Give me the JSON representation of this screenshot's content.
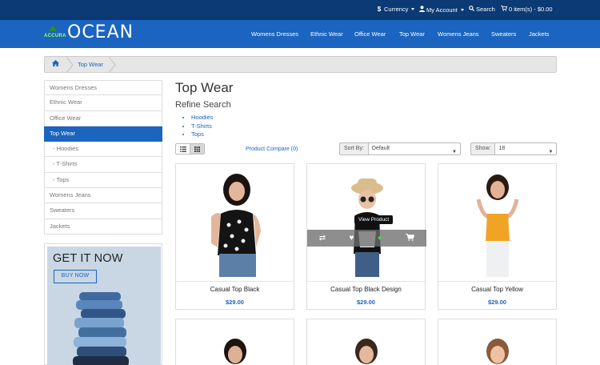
{
  "colors": {
    "topbar": "#0b3a75",
    "header": "#1b64c0",
    "accent": "#1b64c0",
    "active": "#1b64c0"
  },
  "topbar": {
    "currency": {
      "icon": "dollar-icon",
      "label": "Currency"
    },
    "account": {
      "icon": "user-icon",
      "label": "My Account"
    },
    "search": {
      "icon": "search-icon",
      "label": "Search"
    },
    "cart": {
      "icon": "cart-icon",
      "label": "0 item(s) - $0.00"
    }
  },
  "logo": {
    "small": "ACCURA",
    "big": "OCEAN"
  },
  "nav": [
    "Womens Dresses",
    "Ethnic Wear",
    "Office Wear",
    "Top Wear",
    "Womens Jeans",
    "Sweaters",
    "Jackets"
  ],
  "breadcrumb": {
    "home_icon": "home-icon",
    "current": "Top Wear"
  },
  "sidebar": {
    "items": [
      {
        "label": "Womens Dresses"
      },
      {
        "label": "Ethnic Wear"
      },
      {
        "label": "Office Wear"
      },
      {
        "label": "Top Wear"
      },
      {
        "label": "- Hoodies"
      },
      {
        "label": "- T-Shirts"
      },
      {
        "label": "- Tops"
      },
      {
        "label": "Womens Jeans"
      },
      {
        "label": "Sweaters"
      },
      {
        "label": "Jackets"
      }
    ]
  },
  "banner": {
    "title": "GET IT NOW",
    "button": "BUY NOW"
  },
  "main": {
    "title": "Top Wear",
    "refine_title": "Refine Search",
    "refine_links": [
      "Hoodies",
      "T-Shirts",
      "Tops"
    ],
    "compare": "Product Compare (0)",
    "sort_label": "Sort By:",
    "sort_value": "Default",
    "show_label": "Show:",
    "show_value": "18"
  },
  "products": [
    {
      "name": "Casual Top Black",
      "price": "$29.00"
    },
    {
      "name": "Casual Top Black Design",
      "price": "$29.00"
    },
    {
      "name": "Casual Top Yellow",
      "price": "$29.00"
    }
  ],
  "hover": {
    "tooltip": "View Product",
    "icons": [
      "compare-icon",
      "wishlist-heart-icon",
      "view-eye-icon",
      "add-to-cart-icon"
    ]
  }
}
